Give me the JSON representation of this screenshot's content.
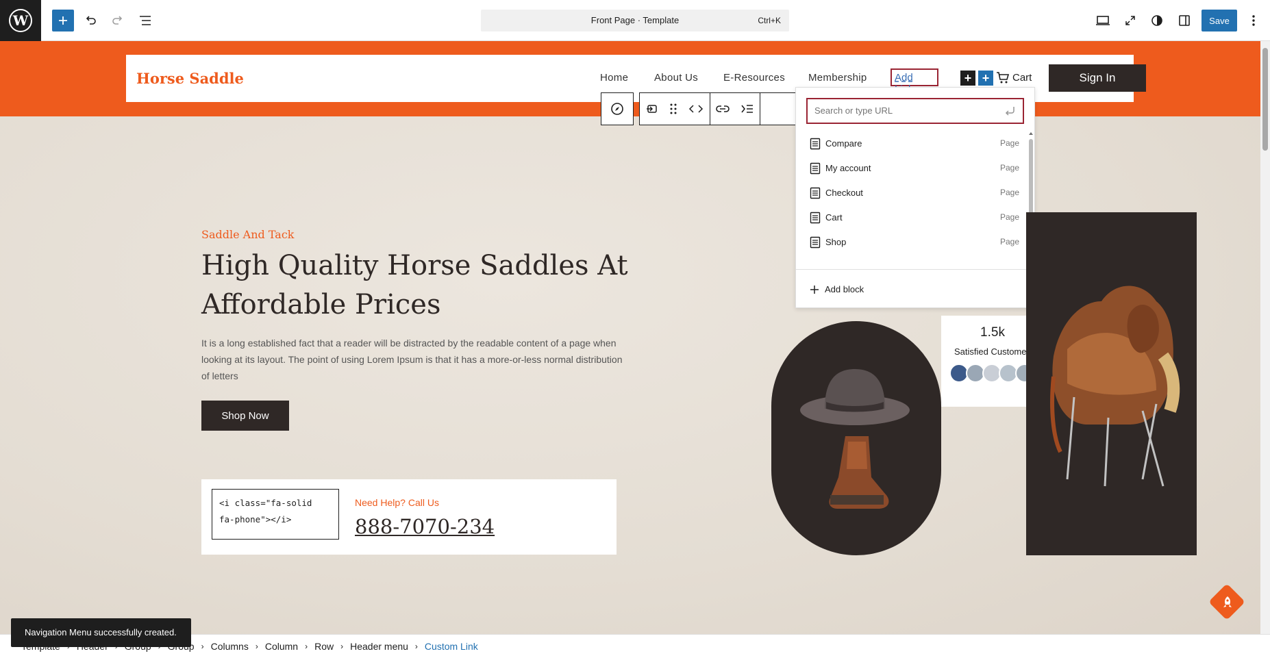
{
  "topbar": {
    "command_title": "Front Page · Template",
    "command_shortcut": "Ctrl+K",
    "save_label": "Save"
  },
  "header": {
    "brand": "Horse Saddle",
    "nav": [
      "Home",
      "About Us",
      "E-Resources",
      "Membership"
    ],
    "add_link_label": "Add Link",
    "cart_label": "Cart",
    "signin_label": "Sign In"
  },
  "link_popover": {
    "placeholder": "Search or type URL",
    "suggestions": [
      {
        "title": "Compare",
        "type": "Page"
      },
      {
        "title": "My account",
        "type": "Page"
      },
      {
        "title": "Checkout",
        "type": "Page"
      },
      {
        "title": "Cart",
        "type": "Page"
      },
      {
        "title": "Shop",
        "type": "Page"
      }
    ],
    "add_block_label": "Add block"
  },
  "hero": {
    "subtitle": "Saddle And Tack",
    "title": "High Quality Horse Saddles At Affordable Prices",
    "description": "It is a long established fact that a reader will be distracted by the readable content of a page when looking at its layout. The point of using Lorem Ipsum is that it has a more-or-less normal distribution of letters",
    "cta_label": "Shop Now",
    "code_snippet": "<i class=\"fa-solid fa-phone\"></i>",
    "help_label": "Need Help? Call Us",
    "phone": "888-7070-234"
  },
  "stats": {
    "value": "1.5k",
    "label": "Satisfied Customers"
  },
  "breadcrumbs": [
    "Template",
    "Header",
    "Group",
    "Group",
    "Columns",
    "Column",
    "Row",
    "Header menu",
    "Custom Link"
  ],
  "snackbar": "Navigation Menu successfully created.",
  "colors": {
    "accent": "#ee5b1d",
    "dark": "#2f2826",
    "wp_blue": "#2271b1",
    "highlight": "#9a2433"
  }
}
